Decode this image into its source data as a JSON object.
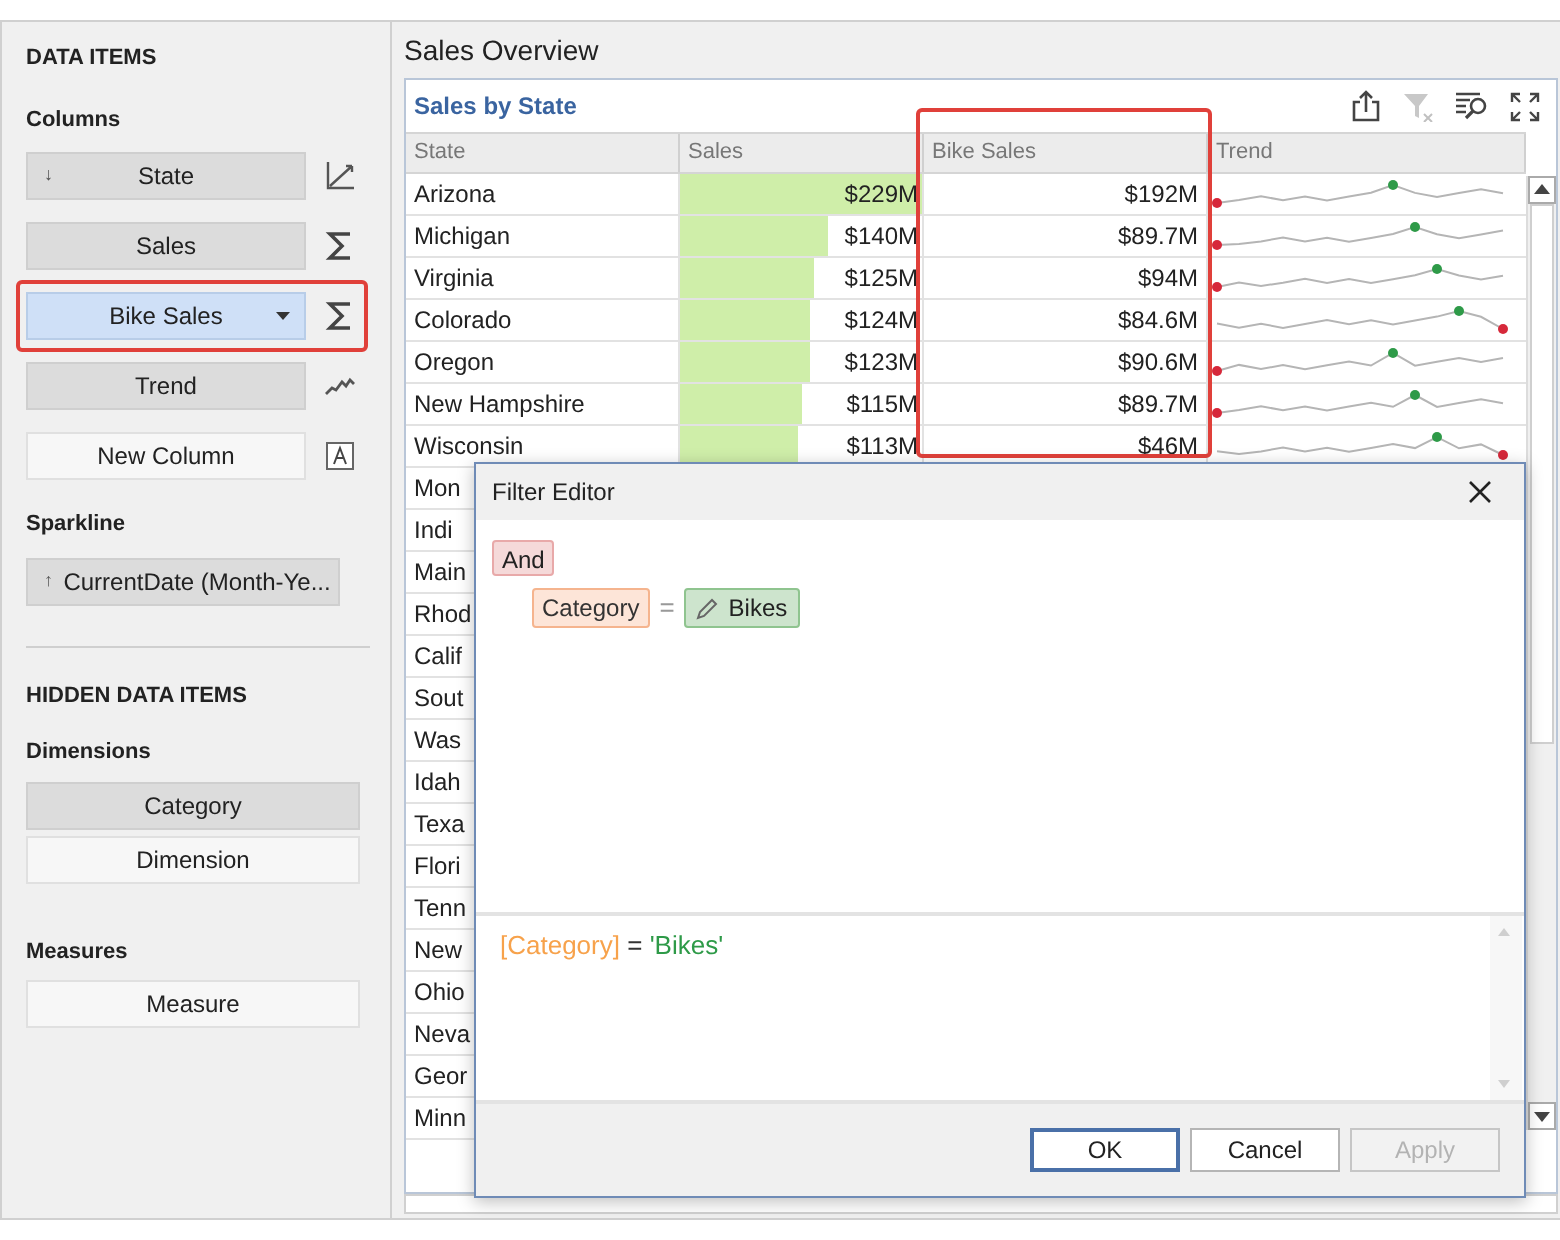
{
  "sidebar": {
    "title": "DATA ITEMS",
    "sections": [
      {
        "heading": "Columns",
        "items": [
          {
            "label": "State",
            "sort": "↓",
            "kind": "dimension",
            "selected": false,
            "empty": false,
            "dropdown": false
          },
          {
            "label": "Sales",
            "kind": "measure",
            "selected": false,
            "empty": false,
            "dropdown": false
          },
          {
            "label": "Bike  Sales",
            "kind": "measure",
            "selected": true,
            "empty": false,
            "dropdown": true,
            "highlighted": true
          },
          {
            "label": "Trend",
            "kind": "sparkline",
            "selected": false,
            "empty": false,
            "dropdown": false
          },
          {
            "label": "New Column",
            "kind": "text",
            "selected": false,
            "empty": true,
            "dropdown": false
          }
        ]
      },
      {
        "heading": "Sparkline",
        "items": [
          {
            "label": "CurrentDate (Month-Ye...",
            "sort": "↑",
            "kind": "none",
            "selected": false,
            "empty": false,
            "dropdown": false
          }
        ]
      }
    ],
    "hidden_title": "HIDDEN DATA ITEMS",
    "hidden_sections": [
      {
        "heading": "Dimensions",
        "items": [
          {
            "label": "Category",
            "empty": false
          },
          {
            "label": "Dimension",
            "empty": true
          }
        ]
      },
      {
        "heading": "Measures",
        "items": [
          {
            "label": "Measure",
            "empty": true
          }
        ]
      }
    ]
  },
  "dashboard": {
    "title": "Sales Overview",
    "card": {
      "title": "Sales by State",
      "columns": [
        {
          "label": "State",
          "highlighted": false
        },
        {
          "label": "Sales",
          "highlighted": false
        },
        {
          "label": "Bike Sales",
          "highlighted": true
        },
        {
          "label": "Trend",
          "highlighted": false
        }
      ],
      "rows": [
        {
          "state": "Arizona",
          "sales": "$229M",
          "level": 1,
          "bike_sales": "$192M"
        },
        {
          "state": "Michigan",
          "sales": "$140M",
          "level": 0.61,
          "bike_sales": "$89.7M"
        },
        {
          "state": "Virginia",
          "sales": "$125M",
          "level": 0.55,
          "bike_sales": "$94M"
        },
        {
          "state": "Colorado",
          "sales": "$124M",
          "level": 0.54,
          "bike_sales": "$84.6M"
        },
        {
          "state": "Oregon",
          "sales": "$123M",
          "level": 0.54,
          "bike_sales": "$90.6M"
        },
        {
          "state": "New Hampshire",
          "sales": "$115M",
          "level": 0.5,
          "bike_sales": "$89.7M"
        },
        {
          "state": "Wisconsin",
          "sales": "$113M",
          "level": 0.49,
          "bike_sales": "$46M"
        },
        {
          "state": "Mon"
        },
        {
          "state": "Indi"
        },
        {
          "state": "Main"
        },
        {
          "state": "Rhod"
        },
        {
          "state": "Calif"
        },
        {
          "state": "Sout"
        },
        {
          "state": "Was"
        },
        {
          "state": "Idah"
        },
        {
          "state": "Texa"
        },
        {
          "state": "Flori"
        },
        {
          "state": "Tenn"
        },
        {
          "state": "New"
        },
        {
          "state": "Ohio"
        },
        {
          "state": "Neva"
        },
        {
          "state": "Geor"
        },
        {
          "state": "Minn"
        }
      ]
    }
  },
  "dialog": {
    "title": "Filter Editor",
    "group": "And",
    "condition": {
      "field": "Category",
      "operator": "=",
      "value": "Bikes"
    },
    "expression": {
      "field": "[Category]",
      "operator": "=",
      "value": "'Bikes'"
    },
    "buttons": [
      {
        "label": "OK",
        "default": true,
        "disabled": false
      },
      {
        "label": "Cancel",
        "default": false,
        "disabled": false
      },
      {
        "label": "Apply",
        "default": false,
        "disabled": true
      }
    ]
  }
}
